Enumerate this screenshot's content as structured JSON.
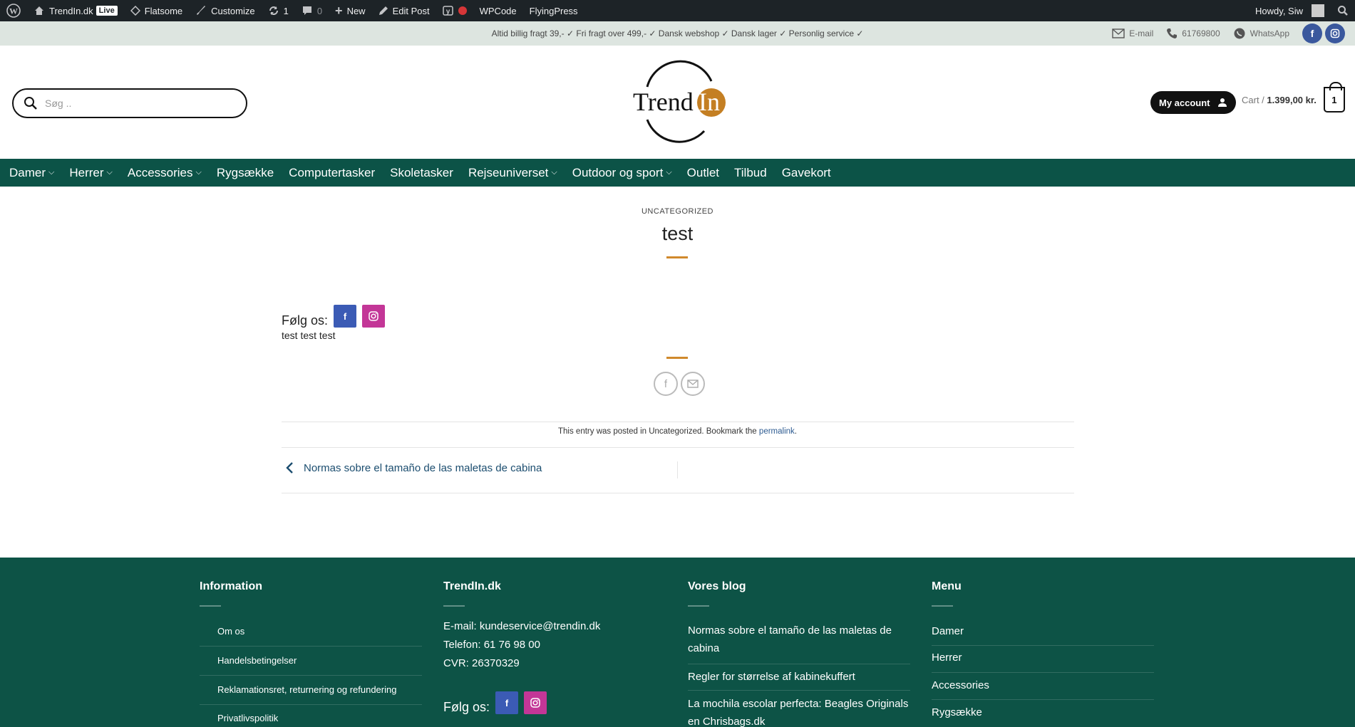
{
  "adminbar": {
    "site_name": "TrendIn.dk",
    "live_badge": "Live",
    "theme": "Flatsome",
    "customize": "Customize",
    "updates_count": "1",
    "comments_count": "0",
    "new": "New",
    "edit_post": "Edit Post",
    "wpcode": "WPCode",
    "flyingpress": "FlyingPress",
    "howdy": "Howdy, Siw"
  },
  "topbar": {
    "promo": "Altid billig fragt 39,- ✓ Fri fragt over 499,- ✓ Dansk webshop ✓ Dansk lager ✓ Personlig service ✓",
    "email": "E-mail",
    "phone": "61769800",
    "whatsapp": "WhatsApp"
  },
  "header": {
    "search_placeholder": "Søg ..",
    "logo_text": "Trend",
    "logo_accent": "In",
    "account_label": "My account",
    "cart_label": "Cart /",
    "cart_total": "1.399,00 kr.",
    "cart_count": "1"
  },
  "nav": {
    "items": [
      {
        "label": "Damer",
        "dropdown": true
      },
      {
        "label": "Herrer",
        "dropdown": true
      },
      {
        "label": "Accessories",
        "dropdown": true
      },
      {
        "label": "Rygsække",
        "dropdown": false
      },
      {
        "label": "Computertasker",
        "dropdown": false
      },
      {
        "label": "Skoletasker",
        "dropdown": false
      },
      {
        "label": "Rejseuniverset",
        "dropdown": true
      },
      {
        "label": "Outdoor og sport",
        "dropdown": true
      },
      {
        "label": "Outlet",
        "dropdown": false
      },
      {
        "label": "Tilbud",
        "dropdown": false
      },
      {
        "label": "Gavekort",
        "dropdown": false
      }
    ]
  },
  "post": {
    "category": "UNCATEGORIZED",
    "title": "test",
    "follow_label": "Følg os:",
    "body": "test test test",
    "entry_prefix": "This entry was posted in Uncategorized. Bookmark the",
    "entry_link": "permalink",
    "entry_suffix": ".",
    "prev_post": "Normas sobre el tamaño de las maletas de cabina"
  },
  "footer": {
    "col1": {
      "heading": "Information",
      "items": [
        "Om os",
        "Handelsbetingelser",
        "Reklamationsret, returnering og refundering",
        "Privatlivspolitik"
      ]
    },
    "col2": {
      "heading": "TrendIn.dk",
      "email": "E-mail: kundeservice@trendin.dk",
      "phone": "Telefon: 61 76 98 00",
      "cvr": "CVR: 26370329",
      "follow_label": "Følg os:"
    },
    "col3": {
      "heading": "Vores blog",
      "items": [
        "Normas sobre el tamaño de las maletas de cabina",
        "Regler for størrelse af kabinekuffert",
        "La mochila escolar perfecta: Beagles Originals en Chrisbags.dk"
      ]
    },
    "col4": {
      "heading": "Menu",
      "items": [
        "Damer",
        "Herrer",
        "Accessories",
        "Rygsække"
      ]
    }
  },
  "colors": {
    "brand_green": "#0c5347",
    "accent_orange": "#c47f23",
    "facebook": "#3b5bb5",
    "instagram": "#c33697"
  }
}
